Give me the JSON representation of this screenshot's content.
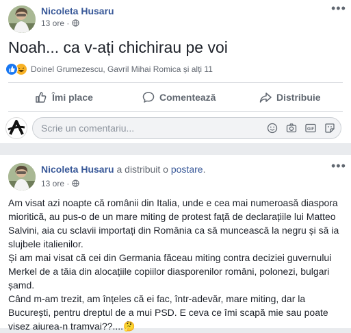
{
  "post1": {
    "author": "Nicoleta Husaru",
    "time": "13 ore",
    "text": "Noah... ca v-ați chichirau pe voi",
    "reactions_text": "Doinel Grumezescu, Gavril Mihai Romica și alți 11",
    "actions": {
      "like": "Îmi place",
      "comment": "Comentează",
      "share": "Distribuie"
    },
    "comment_placeholder": "Scrie un comentariu..."
  },
  "post2": {
    "author": "Nicoleta Husaru",
    "shared_text": "a distribuit o",
    "shared_link": "postare",
    "shared_end": ".",
    "time": "13 ore",
    "paragraphs": [
      "Am visat azi noapte că românii din Italia, unde e cea mai numeroasă diaspora mioritică, au pus-o de un mare miting de protest față de declarațiile lui Matteo Salvini, aia cu sclavii importați din România ca să muncească la negru și să ia slujbele italienilor.",
      "Și am mai visat că cei din Germania făceau miting contra deciziei guvernului Merkel de a tăia din alocațiile copiilor diasporenilor români, polonezi, bulgari șamd.",
      "Când m-am trezit, am înțeles că ei fac, într-adevăr, mare miting, dar la București, pentru dreptul de a mui PSD. E ceva ce îmi scapă mie sau poate visez aiurea-n tramvai??....",
      "🤔"
    ]
  },
  "colors": {
    "link": "#385898",
    "muted": "#616770",
    "like_blue": "#1877f2",
    "haha_yellow": "#f7b125"
  },
  "icons": [
    "more-options-icon",
    "globe-icon",
    "like-reaction-icon",
    "haha-reaction-icon",
    "thumbs-up-icon",
    "comment-icon",
    "share-arrow-icon",
    "smiley-icon",
    "camera-icon",
    "gif-icon",
    "sticker-icon"
  ]
}
